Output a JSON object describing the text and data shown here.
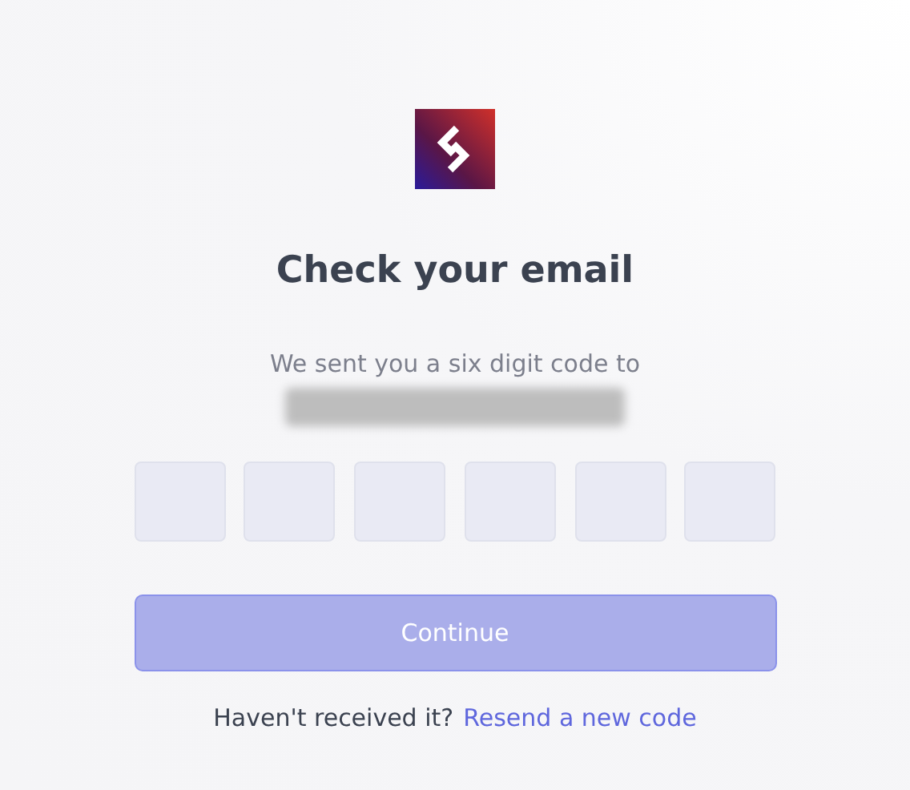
{
  "title": "Check your email",
  "message": "We sent you a six digit code to",
  "code_boxes": [
    {
      "filled": false
    },
    {
      "filled": false
    },
    {
      "filled": false
    },
    {
      "filled": false
    },
    {
      "filled": false
    },
    {
      "filled": false
    }
  ],
  "continue_button": {
    "label": "Continue",
    "disabled": true
  },
  "footer": {
    "text": "Haven't received it?",
    "link": "Resend a new code"
  }
}
